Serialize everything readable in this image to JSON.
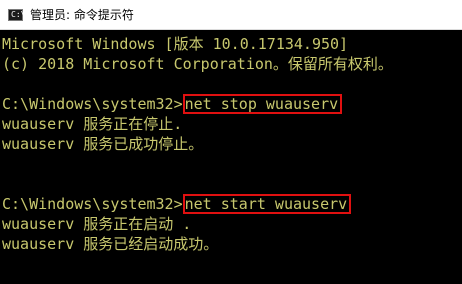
{
  "window": {
    "title": "管理员: 命令提示符",
    "icon": "cmd-icon",
    "icon_glyph": "C:\\"
  },
  "colors": {
    "console_bg": "#000000",
    "console_text": "#c8c86e",
    "highlight_border": "#e01010",
    "titlebar_bg": "#ffffff"
  },
  "console": {
    "header_line1": "Microsoft Windows [版本 10.0.17134.950]",
    "header_line2": "(c) 2018 Microsoft Corporation。保留所有权利。",
    "block1": {
      "prompt": "C:\\Windows\\system32>",
      "command": "net stop wuauserv",
      "output1": "wuauserv 服务正在停止.",
      "output2": "wuauserv 服务已成功停止。"
    },
    "block2": {
      "prompt": "C:\\Windows\\system32>",
      "command": "net start wuauserv",
      "output1": "wuauserv 服务正在启动 .",
      "output2": "wuauserv 服务已经启动成功。"
    }
  }
}
